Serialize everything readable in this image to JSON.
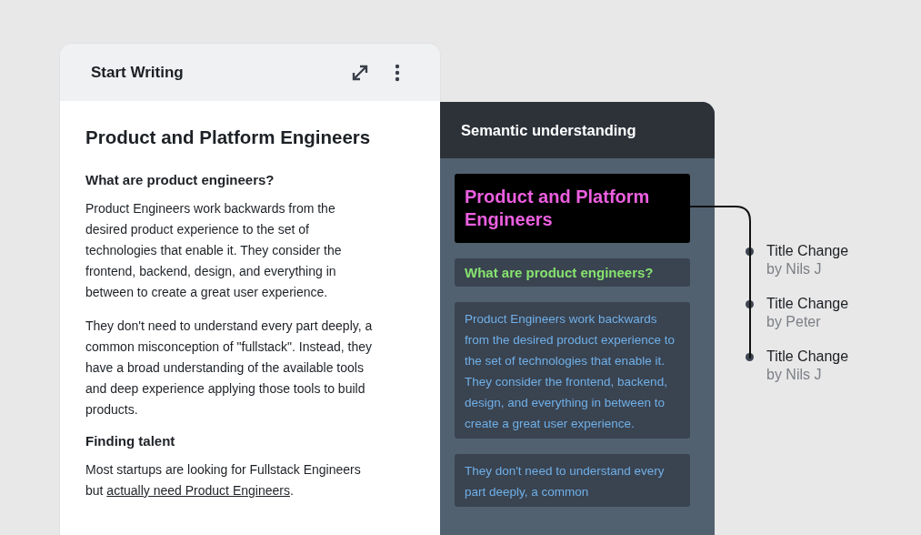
{
  "editor": {
    "title": "Start Writing",
    "document_title": "Product and Platform Engineers",
    "sections": [
      {
        "heading": "What are product engineers?",
        "paragraphs": [
          {
            "segments": [
              {
                "kind": "text",
                "text": "Product Engineers work backwards from the desired product experience to the set of technologies that enable it. They consider the frontend, backend, design, and everything in between to create a great user experience."
              }
            ]
          },
          {
            "segments": [
              {
                "kind": "text",
                "text": "They don't need to understand every part deeply, a common misconception of \"fullstack\". Instead, they have a broad understanding of the available tools and deep experience applying those tools to build products."
              }
            ]
          }
        ]
      },
      {
        "heading": "Finding talent",
        "paragraphs": [
          {
            "segments": [
              {
                "kind": "text",
                "text": "Most startups are looking for Fullstack Engineers but "
              },
              {
                "kind": "link",
                "text": "actually need Product Engineers"
              },
              {
                "kind": "text",
                "text": "."
              }
            ]
          }
        ]
      }
    ]
  },
  "semantic": {
    "title": "Semantic understanding",
    "blocks": [
      {
        "kind": "title",
        "text": "Product and Platform Engineers"
      },
      {
        "kind": "heading",
        "text": "What are product engineers?"
      },
      {
        "kind": "paragraph",
        "text": "Product Engineers work backwards from the desired product experience to the set of technologies that enable it. They consider the frontend, backend, design, and everything in between to create a great user experience."
      },
      {
        "kind": "paragraph",
        "text": "They don't need to understand every part deeply, a common"
      }
    ]
  },
  "history": [
    {
      "title": "Title Change",
      "author": "by Nils J"
    },
    {
      "title": "Title Change",
      "author": "by Peter"
    },
    {
      "title": "Title Change",
      "author": "by Nils J"
    }
  ]
}
